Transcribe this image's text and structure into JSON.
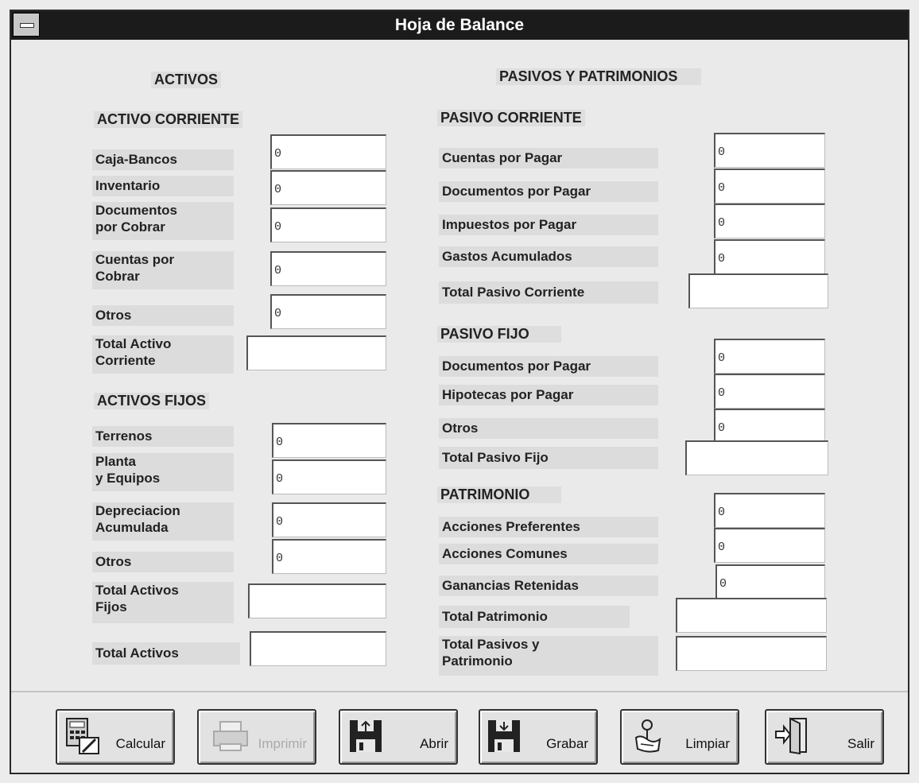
{
  "window": {
    "title": "Hoja de Balance"
  },
  "left": {
    "header": "ACTIVOS",
    "corriente": {
      "title": "ACTIVO CORRIENTE",
      "rows": [
        {
          "label": "Caja-Bancos",
          "value": "0"
        },
        {
          "label": "Inventario",
          "value": "0"
        },
        {
          "label1": "Documentos",
          "label2": "por Cobrar",
          "value": "0"
        },
        {
          "label1": "Cuentas por",
          "label2": "Cobrar",
          "value": "0"
        },
        {
          "label": "Otros",
          "value": "0"
        }
      ],
      "total": {
        "label1": "Total Activo",
        "label2": "Corriente",
        "value": ""
      }
    },
    "fijos": {
      "title": "ACTIVOS FIJOS",
      "rows": [
        {
          "label": "Terrenos",
          "value": "0"
        },
        {
          "label1": "Planta",
          "label2": "y Equipos",
          "value": "0"
        },
        {
          "label1": "Depreciacion",
          "label2": "Acumulada",
          "value": "0"
        },
        {
          "label": "Otros",
          "value": "0"
        }
      ],
      "total": {
        "label1": "Total Activos",
        "label2": "Fijos",
        "value": ""
      }
    },
    "total": {
      "label": "Total Activos",
      "value": ""
    }
  },
  "right": {
    "header": "PASIVOS Y PATRIMONIOS",
    "corriente": {
      "title": "PASIVO CORRIENTE",
      "rows": [
        {
          "label": "Cuentas por Pagar",
          "value": "0"
        },
        {
          "label": "Documentos por Pagar",
          "value": "0"
        },
        {
          "label": "Impuestos por Pagar",
          "value": "0"
        },
        {
          "label": "Gastos Acumulados",
          "value": "0"
        }
      ],
      "total": {
        "label": "Total Pasivo Corriente",
        "value": ""
      }
    },
    "fijo": {
      "title": "PASIVO FIJO",
      "rows": [
        {
          "label": "Documentos por Pagar",
          "value": "0"
        },
        {
          "label": "Hipotecas por Pagar",
          "value": "0"
        },
        {
          "label": "Otros",
          "value": "0"
        }
      ],
      "total": {
        "label": "Total Pasivo Fijo",
        "value": ""
      }
    },
    "patrimonio": {
      "title": "PATRIMONIO",
      "rows": [
        {
          "label": "Acciones Preferentes",
          "value": "0"
        },
        {
          "label": "Acciones Comunes",
          "value": "0"
        },
        {
          "label": "Ganancias Retenidas",
          "value": "0"
        }
      ],
      "total": {
        "label": "Total Patrimonio",
        "value": ""
      }
    },
    "grand_total": {
      "label1": "Total Pasivos y",
      "label2": "Patrimonio",
      "value": ""
    }
  },
  "buttons": {
    "calcular": {
      "label": "Calcular",
      "icon": "calculator-icon",
      "enabled": true
    },
    "imprimir": {
      "label": "Imprimir",
      "icon": "printer-icon",
      "enabled": false
    },
    "abrir": {
      "label": "Abrir",
      "icon": "floppy-open-icon",
      "enabled": true
    },
    "grabar": {
      "label": "Grabar",
      "icon": "floppy-save-icon",
      "enabled": true
    },
    "limpiar": {
      "label": "Limpiar",
      "icon": "eraser-hand-icon",
      "enabled": true
    },
    "salir": {
      "label": "Salir",
      "icon": "exit-door-icon",
      "enabled": true
    }
  }
}
